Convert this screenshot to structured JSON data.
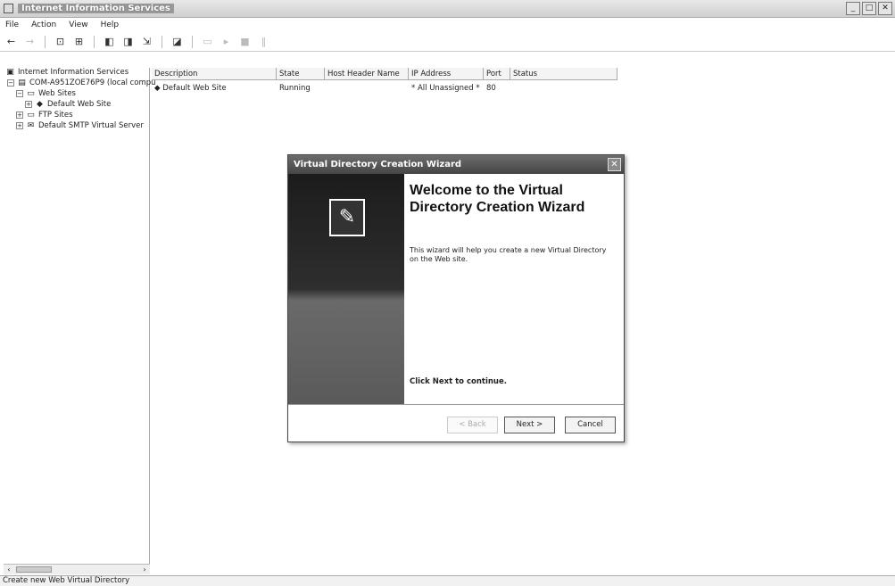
{
  "window": {
    "title": "Internet Information Services",
    "buttons": [
      "_",
      "□",
      "✕"
    ]
  },
  "menu": [
    "File",
    "Action",
    "View",
    "Help"
  ],
  "toolbar": {
    "icons": [
      "back-icon",
      "forward-icon",
      "up-icon",
      "show-tree-icon",
      "properties-icon",
      "refresh-icon",
      "export-icon",
      "help-icon",
      "play-icon",
      "stop-icon",
      "pause-icon"
    ]
  },
  "tree": {
    "nodes": [
      {
        "label": "Internet Information Services",
        "expander": "",
        "icon": "▣"
      },
      {
        "label": "COM-A951ZOE76P9 (local compu",
        "expander": "−",
        "icon": "▤"
      },
      {
        "label": "Web Sites",
        "expander": "−",
        "icon": "▭"
      },
      {
        "label": "Default Web Site",
        "expander": "+",
        "icon": "◆"
      },
      {
        "label": "FTP Sites",
        "expander": "+",
        "icon": "▭"
      },
      {
        "label": "Default SMTP Virtual Server",
        "expander": "+",
        "icon": "✉"
      }
    ]
  },
  "list": {
    "columns": [
      "Description",
      "State",
      "Host Header Name",
      "IP Address",
      "Port",
      "Status"
    ],
    "rows": [
      {
        "description": "Default Web Site",
        "state": "Running",
        "host": "",
        "ip": "* All Unassigned *",
        "port": "80",
        "status": ""
      }
    ]
  },
  "status_bar": {
    "text": "Create new Web Virtual Directory"
  },
  "dialog": {
    "title": "Virtual Directory Creation Wizard",
    "heading": "Welcome to the Virtual Directory Creation Wizard",
    "description": "This wizard will help you create a new Virtual Directory on the Web site.",
    "next_hint": "Click Next to continue.",
    "back_label": "< Back",
    "next_label": "Next >",
    "cancel_label": "Cancel",
    "close_symbol": "✕"
  }
}
